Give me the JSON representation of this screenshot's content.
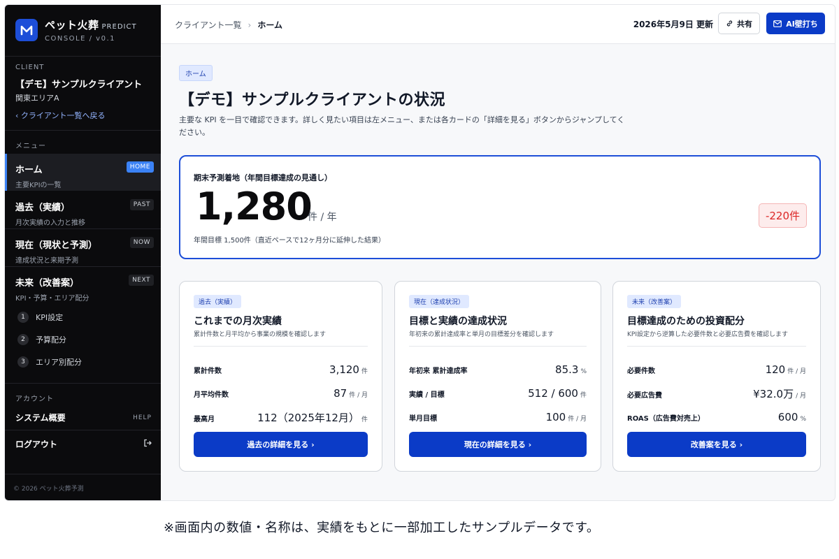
{
  "brand": {
    "name": "ペット火葬",
    "tag": "PREDICT",
    "subtitle": "CONSOLE / v0.1",
    "logo_icon": "m-logo-icon"
  },
  "client": {
    "section_label": "CLIENT",
    "name": "【デモ】サンプルクライアント",
    "area": "関東エリアA",
    "back_link": "クライアント一覧へ戻る"
  },
  "menu": {
    "section_label": "メニュー",
    "items": [
      {
        "title": "ホーム",
        "sub": "主要KPIの一覧",
        "badge": "HOME",
        "active": true
      },
      {
        "title": "過去（実績）",
        "sub": "月次実績の入力と推移",
        "badge": "PAST",
        "active": false
      },
      {
        "title": "現在（現状と予測）",
        "sub": "達成状況と来期予測",
        "badge": "NOW",
        "active": false
      },
      {
        "title": "未来（改善案）",
        "sub": "KPI・予算・エリア配分",
        "badge": "NEXT",
        "active": false
      }
    ],
    "sub_items": [
      {
        "num": "1",
        "label": "KPI設定"
      },
      {
        "num": "2",
        "label": "予算配分"
      },
      {
        "num": "3",
        "label": "エリア別配分"
      }
    ]
  },
  "account": {
    "section_label": "アカウント",
    "system_label": "システム概要",
    "system_right": "HELP",
    "logout_label": "ログアウト"
  },
  "footer": "© 2026 ペット火葬予測",
  "topbar": {
    "breadcrumb_parent": "クライアント一覧",
    "breadcrumb_sep": "›",
    "breadcrumb_current": "ホーム",
    "updated": "2026年5月9日 更新",
    "share_label": "共有",
    "ai_label": "AI壁打ち"
  },
  "page": {
    "chip": "ホーム",
    "title": "【デモ】サンプルクライアントの状況",
    "description": "主要な KPI を一目で確認できます。詳しく見たい項目は左メニュー、または各カードの「詳細を見る」ボタンからジャンプしてください。"
  },
  "hero": {
    "label": "期末予測着地（年間目標達成の見通し）",
    "value": "1,280",
    "unit": "件 / 年",
    "note": "年間目標 1,500件（直近ペースで12ヶ月分に延伸した結果）",
    "delta": "-220件",
    "delta_color": "#dc2626"
  },
  "cards": [
    {
      "tag": "過去（実績）",
      "title": "これまでの月次実績",
      "sub": "累計件数と月平均から事業の規模を確認します",
      "rows": [
        {
          "label": "累計件数",
          "value": "3,120",
          "unit": "件"
        },
        {
          "label": "月平均件数",
          "value": "87",
          "unit": "件 / 月"
        },
        {
          "label": "最高月",
          "value": "112（2025年12月）",
          "unit": "件"
        }
      ],
      "button": "過去の詳細を見る ›"
    },
    {
      "tag": "現在（達成状況）",
      "title": "目標と実績の達成状況",
      "sub": "年初来の累計達成率と単月の目標差分を確認します",
      "rows": [
        {
          "label": "年初来 累計達成率",
          "value": "85.3",
          "unit": "%"
        },
        {
          "label": "実績 / 目標",
          "value": "512 / 600",
          "unit": "件"
        },
        {
          "label": "単月目標",
          "value": "100",
          "unit": "件 / 月"
        }
      ],
      "button": "現在の詳細を見る ›"
    },
    {
      "tag": "未来（改善案）",
      "title": "目標達成のための投資配分",
      "sub": "KPI設定から逆算した必要件数と必要広告費を確認します",
      "rows": [
        {
          "label": "必要件数",
          "value": "120",
          "unit": "件 / 月"
        },
        {
          "label": "必要広告費",
          "value": "¥32.0万",
          "unit": "/ 月"
        },
        {
          "label": "ROAS（広告費対売上）",
          "value": "600",
          "unit": "%"
        }
      ],
      "button": "改善案を見る ›"
    }
  ],
  "footnote": "※画面内の数値・名称は、実績をもとに一部加工したサンプルデータです。",
  "colors": {
    "accent": "#0b3bc7",
    "sidebar_bg": "#0b0b0d",
    "active_badge": "#3b82f6",
    "negative": "#dc2626"
  }
}
